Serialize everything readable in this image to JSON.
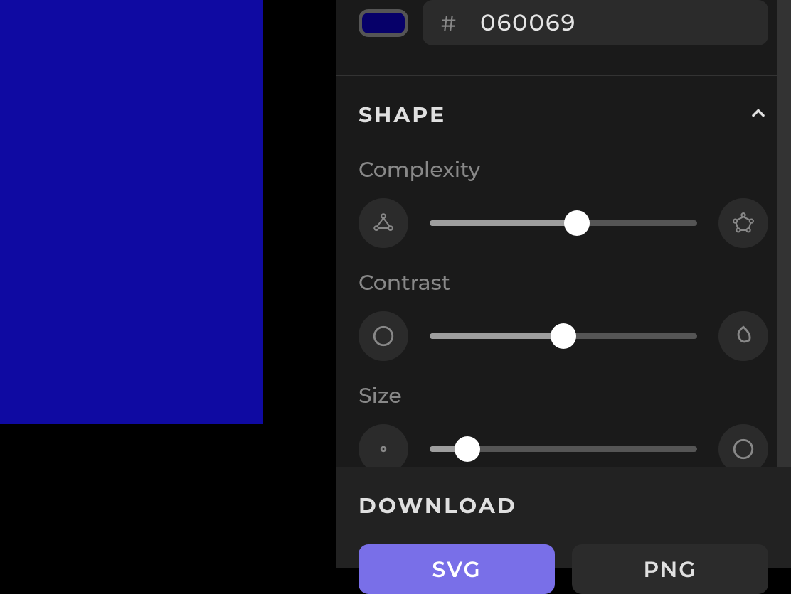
{
  "preview": {
    "color": "#0f0aa2"
  },
  "color": {
    "hash": "#",
    "hex": "060069"
  },
  "shape": {
    "title": "SHAPE",
    "controls": {
      "complexity": {
        "label": "Complexity",
        "value": 55
      },
      "contrast": {
        "label": "Contrast",
        "value": 50
      },
      "size": {
        "label": "Size",
        "value": 14
      }
    }
  },
  "download": {
    "title": "DOWNLOAD",
    "svg_label": "SVG",
    "png_label": "PNG"
  }
}
